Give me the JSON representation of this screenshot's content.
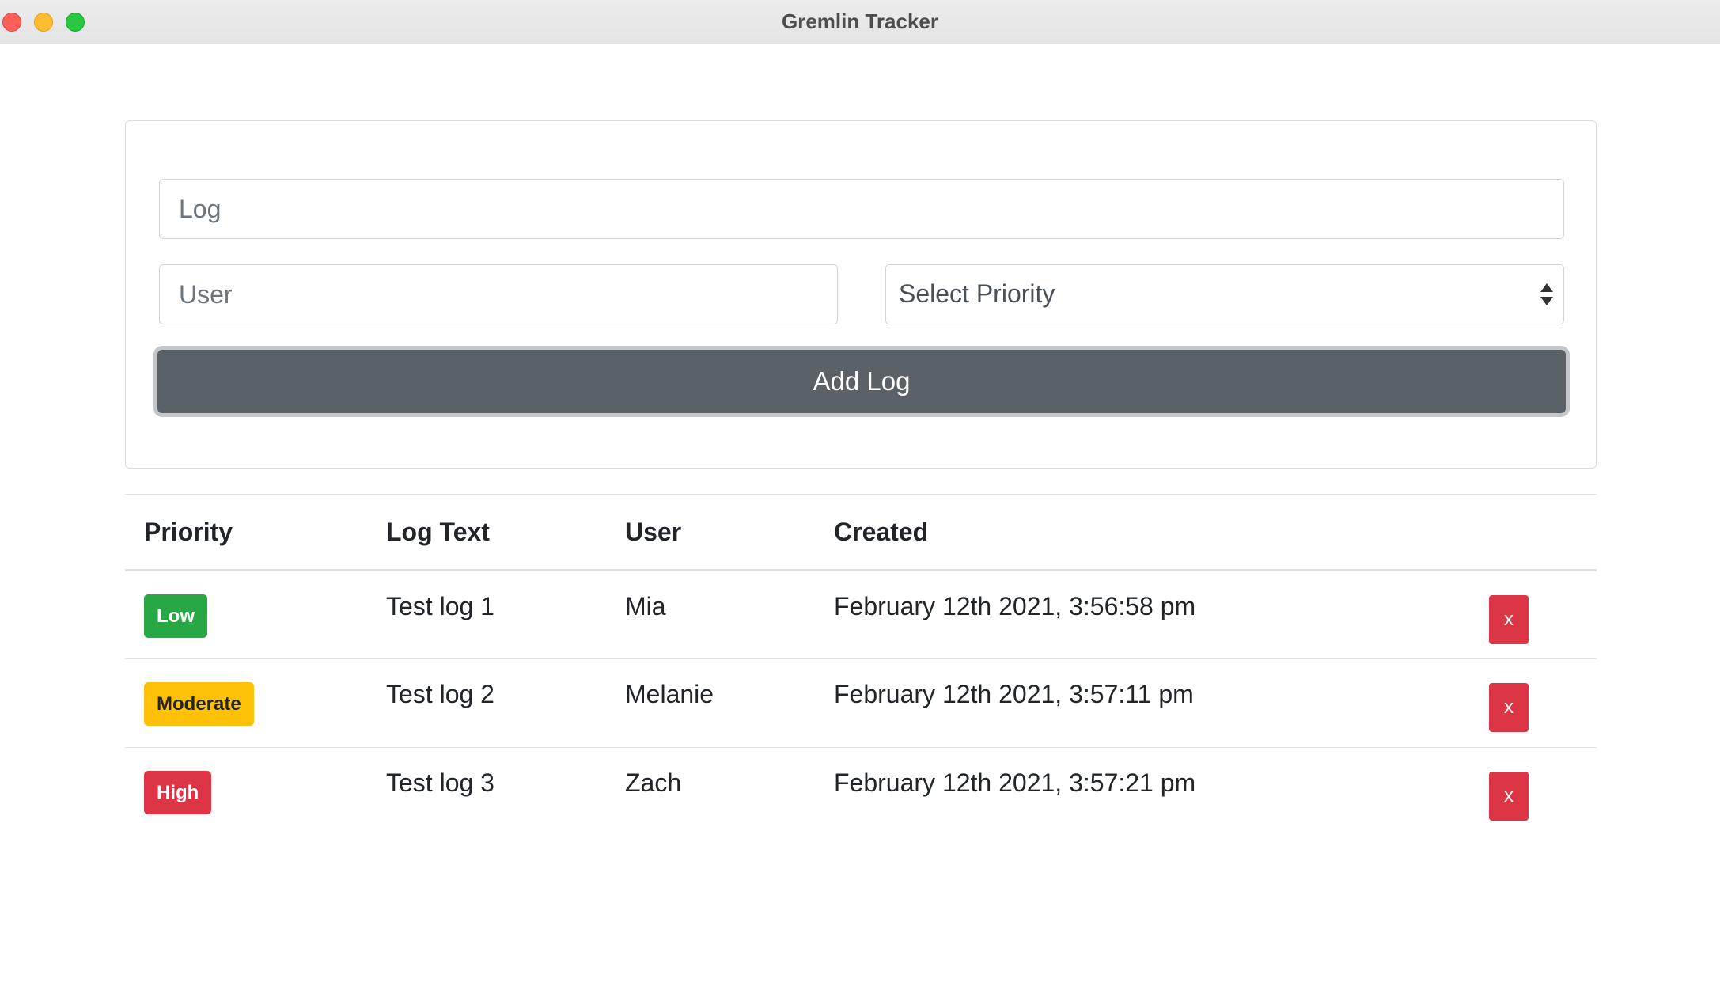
{
  "window": {
    "title": "Gremlin Tracker"
  },
  "form": {
    "log_placeholder": "Log",
    "user_placeholder": "User",
    "priority_select_value": "Select Priority",
    "add_button_label": "Add Log",
    "button_color": "#5a6268"
  },
  "table": {
    "headers": {
      "priority": "Priority",
      "log_text": "Log Text",
      "user": "User",
      "created": "Created"
    },
    "rows": [
      {
        "priority": "Low",
        "priority_color": "#28a745",
        "log_text": "Test log 1",
        "user": "Mia",
        "created": "February 12th 2021, 3:56:58 pm",
        "delete_label": "x"
      },
      {
        "priority": "Moderate",
        "priority_color": "#ffc107",
        "log_text": "Test log 2",
        "user": "Melanie",
        "created": "February 12th 2021, 3:57:11 pm",
        "delete_label": "x"
      },
      {
        "priority": "High",
        "priority_color": "#dc3545",
        "log_text": "Test log 3",
        "user": "Zach",
        "created": "February 12th 2021, 3:57:21 pm",
        "delete_label": "x"
      }
    ]
  }
}
